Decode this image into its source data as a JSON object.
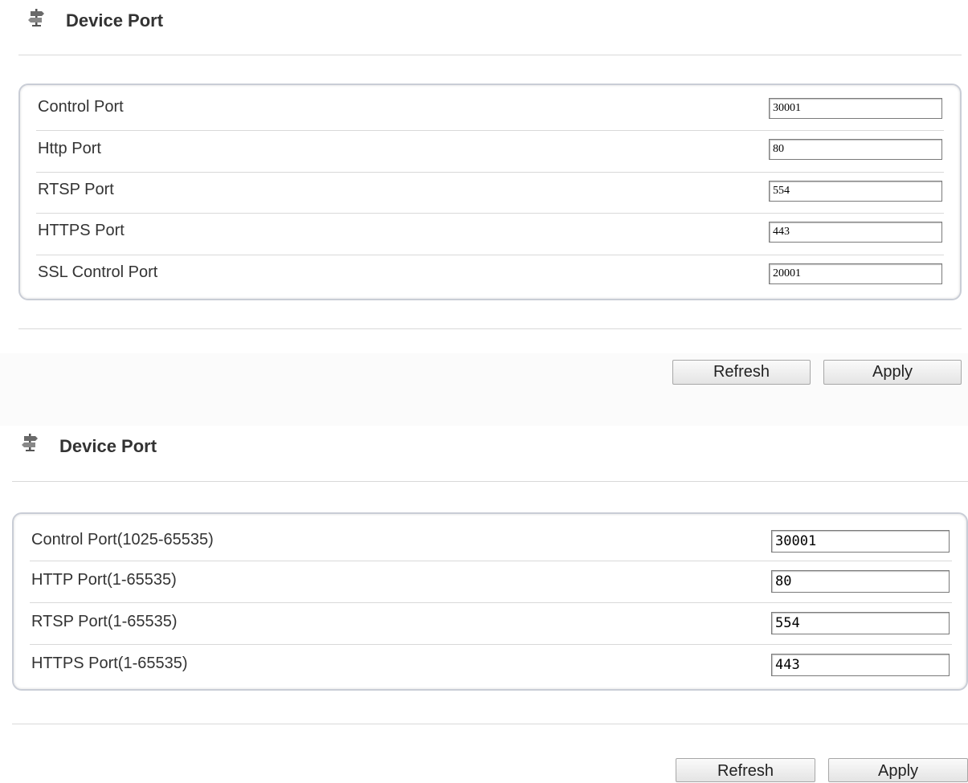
{
  "panels": [
    {
      "title": "Device Port",
      "title_icon": "signpost-icon",
      "rows": [
        {
          "label": "Control Port",
          "value": "30001"
        },
        {
          "label": "Http Port",
          "value": "80"
        },
        {
          "label": "RTSP Port",
          "value": "554"
        },
        {
          "label": "HTTPS Port",
          "value": "443"
        },
        {
          "label": "SSL Control Port",
          "value": "20001"
        }
      ],
      "buttons": {
        "refresh": "Refresh",
        "apply": "Apply"
      }
    },
    {
      "title": "Device Port",
      "title_icon": "signpost-icon",
      "rows": [
        {
          "label": "Control Port(1025-65535)",
          "value": "30001"
        },
        {
          "label": "HTTP Port(1-65535)",
          "value": "80"
        },
        {
          "label": "RTSP Port(1-65535)",
          "value": "554"
        },
        {
          "label": "HTTPS Port(1-65535)",
          "value": "443"
        }
      ],
      "buttons": {
        "refresh": "Refresh",
        "apply": "Apply"
      }
    }
  ]
}
